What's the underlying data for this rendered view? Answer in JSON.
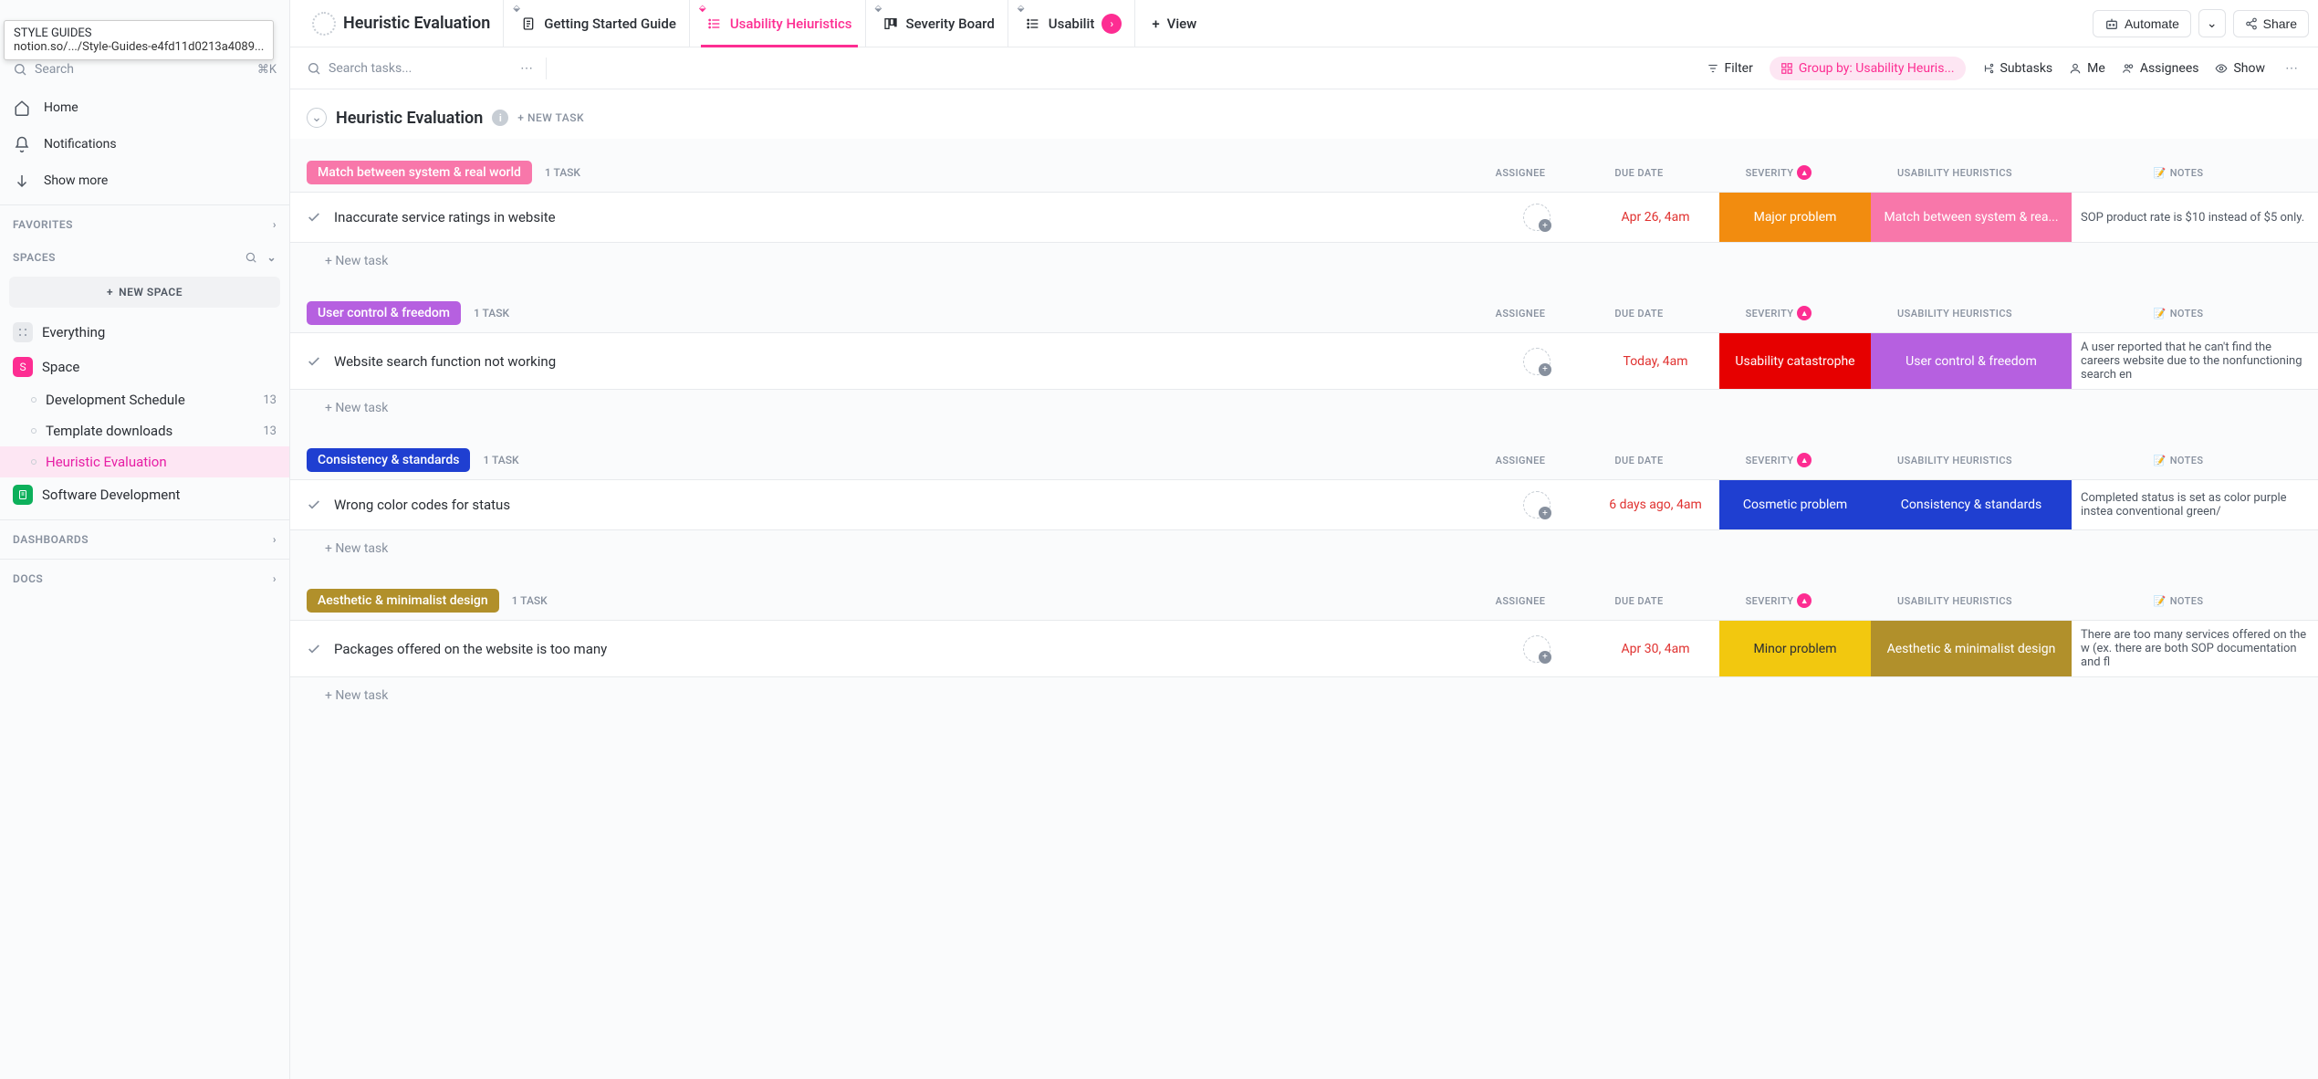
{
  "tooltip": {
    "title": "STYLE GUIDES",
    "url": "notion.so/.../Style-Guides-e4fd11d0213a4089..."
  },
  "sidebar": {
    "search_placeholder": "Search",
    "search_kbd": "⌘K",
    "nav": [
      {
        "label": "Home",
        "icon": "home"
      },
      {
        "label": "Notifications",
        "icon": "bell"
      },
      {
        "label": "Show more",
        "icon": "arrow-down"
      }
    ],
    "favorites_header": "FAVORITES",
    "spaces_header": "SPACES",
    "new_space_label": "NEW SPACE",
    "items": [
      {
        "label": "Everything",
        "badge_type": "grey"
      },
      {
        "label": "Space",
        "badge_type": "pink",
        "badge_text": "S"
      },
      {
        "label": "Development Schedule",
        "indent": true,
        "count": "13"
      },
      {
        "label": "Template downloads",
        "indent": true,
        "count": "13"
      },
      {
        "label": "Heuristic Evaluation",
        "indent": true,
        "active": true
      },
      {
        "label": "Software Development",
        "badge_type": "green"
      }
    ],
    "dashboards_header": "DASHBOARDS",
    "docs_header": "DOCS"
  },
  "tabs": {
    "title": "Heuristic Evaluation",
    "items": [
      {
        "label": "Getting Started Guide",
        "icon": "doc"
      },
      {
        "label": "Usability Heiuristics",
        "icon": "list",
        "active": true
      },
      {
        "label": "Severity Board",
        "icon": "board"
      },
      {
        "label": "Usabilit",
        "icon": "list",
        "truncated": true
      }
    ],
    "add_view": "View",
    "automate": "Automate",
    "share": "Share"
  },
  "toolbar": {
    "search_placeholder": "Search tasks...",
    "filter": "Filter",
    "group_by": "Group by: Usability Heuris...",
    "subtasks": "Subtasks",
    "me": "Me",
    "assignees": "Assignees",
    "show": "Show"
  },
  "list": {
    "title": "Heuristic Evaluation",
    "new_task_label": "+ NEW TASK",
    "columns": {
      "assignee": "ASSIGNEE",
      "due": "DUE DATE",
      "severity": "SEVERITY",
      "heuristics": "USABILITY HEURISTICS",
      "notes": "NOTES"
    },
    "new_task_row": "+ New task",
    "groups": [
      {
        "label": "Match between system & real world",
        "color": "#f877aa",
        "count": "1 TASK",
        "tasks": [
          {
            "title": "Inaccurate service ratings in website",
            "due": "Apr 26, 4am",
            "severity": "Major problem",
            "severity_color": "#f28c0f",
            "heuristic": "Match between system & rea...",
            "heuristic_color": "#f877aa",
            "notes": "SOP product rate is $10 instead of $5 only."
          }
        ]
      },
      {
        "label": "User control & freedom",
        "color": "#b660e0",
        "count": "1 TASK",
        "tasks": [
          {
            "title": "Website search function not working",
            "due": "Today, 4am",
            "severity": "Usability catastrophe",
            "severity_color": "#e60000",
            "heuristic": "User control & freedom",
            "heuristic_color": "#b660e0",
            "notes": "A user reported that he can't find the careers website due to the nonfunctioning search en"
          }
        ]
      },
      {
        "label": "Consistency & standards",
        "color": "#1f3fd1",
        "count": "1 TASK",
        "tasks": [
          {
            "title": "Wrong color codes for status",
            "due": "6 days ago, 4am",
            "severity": "Cosmetic problem",
            "severity_color": "#1f3fd1",
            "heuristic": "Consistency & standards",
            "heuristic_color": "#1f3fd1",
            "notes": "Completed status is set as color purple instea conventional green/"
          }
        ]
      },
      {
        "label": "Aesthetic & minimalist design",
        "color": "#b1902b",
        "count": "1 TASK",
        "tasks": [
          {
            "title": "Packages offered on the website is too many",
            "due": "Apr 30, 4am",
            "severity": "Minor problem",
            "severity_color": "#f2c80f",
            "severity_text_dark": true,
            "heuristic": "Aesthetic & minimalist design",
            "heuristic_color": "#b1902b",
            "notes": "There are too many services offered on the w (ex. there are both SOP documentation and fl"
          }
        ]
      }
    ]
  }
}
